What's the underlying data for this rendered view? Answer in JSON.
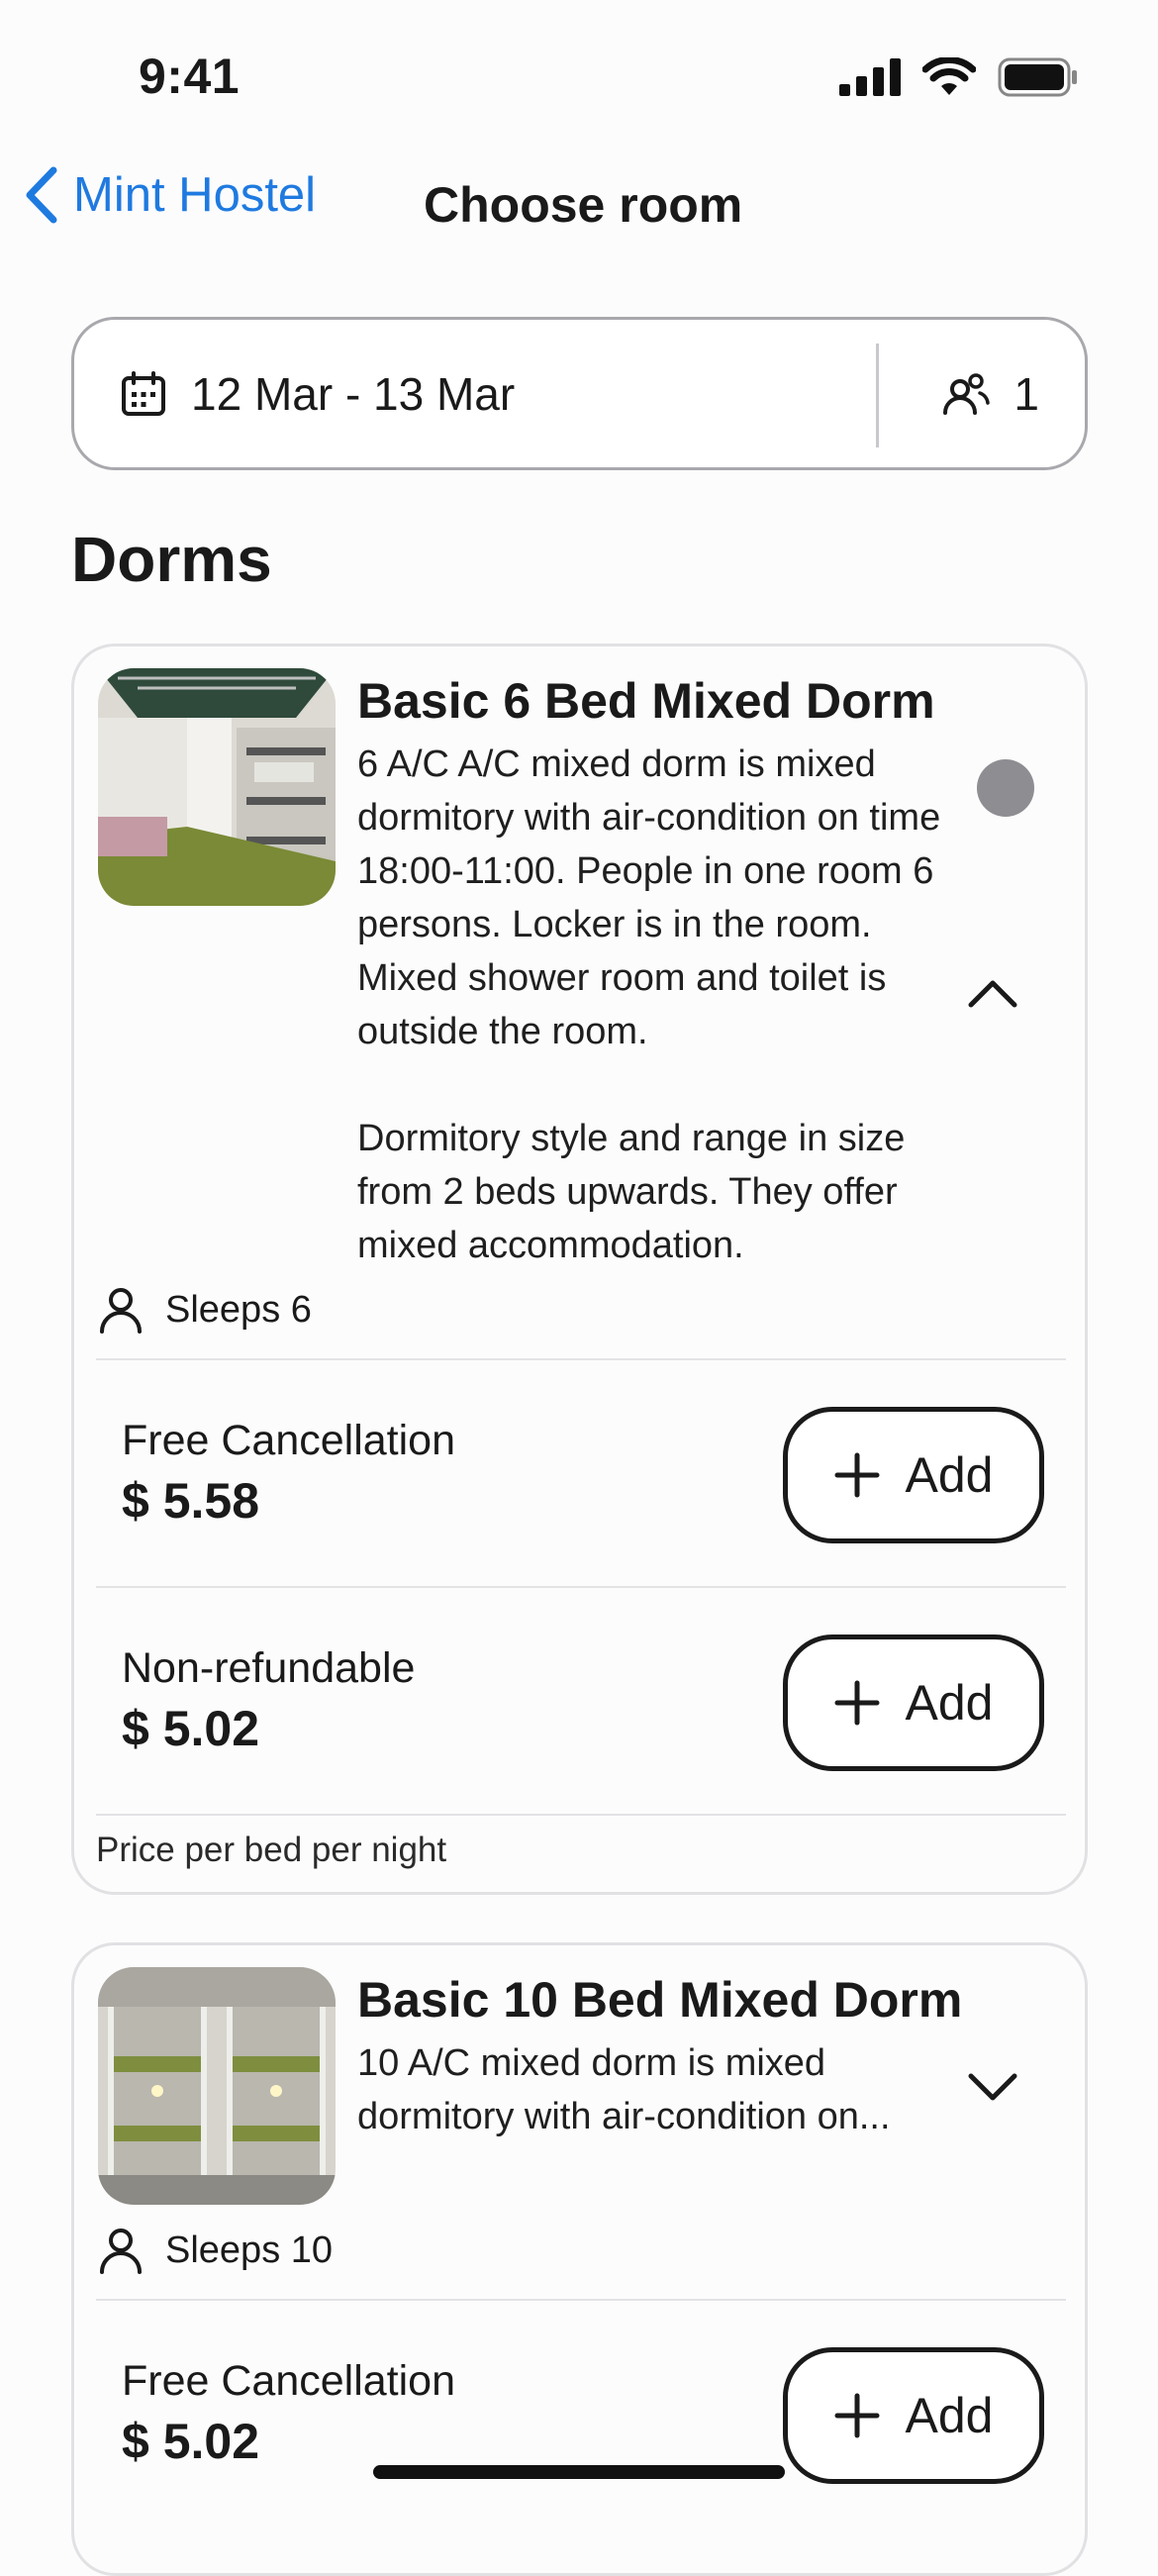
{
  "status_bar": {
    "time": "9:41"
  },
  "nav": {
    "back_label": "Mint Hostel",
    "title": "Choose room"
  },
  "search": {
    "dates": "12 Mar - 13 Mar",
    "guests": "1"
  },
  "section": {
    "title": "Dorms"
  },
  "rooms": [
    {
      "name": "Basic 6 Bed Mixed Dorm",
      "description": "6 A/C A/C mixed dorm is mixed dormitory with air-condition on time 18:00-11:00. People in one room 6 persons. Locker is in the room. Mixed shower room and toilet is outside the room.\n\nDormitory style and range in size from 2 beds upwards.  They offer mixed accommodation.",
      "sleeps": "Sleeps 6",
      "expanded": true,
      "rates": [
        {
          "label": "Free Cancellation",
          "price": "$ 5.58",
          "button": "Add"
        },
        {
          "label": "Non-refundable",
          "price": "$ 5.02",
          "button": "Add"
        }
      ],
      "footnote": "Price per bed per night"
    },
    {
      "name": "Basic 10 Bed Mixed Dorm",
      "description": "10 A/C mixed dorm is mixed dormitory with air-condition on...",
      "sleeps": "Sleeps 10",
      "expanded": false,
      "rates": [
        {
          "label": "Free Cancellation",
          "price": "$ 5.02",
          "button": "Add"
        }
      ]
    }
  ],
  "icons": {
    "back": "chevron-left-icon",
    "calendar": "calendar-icon",
    "guests": "users-icon",
    "person": "person-icon",
    "plus": "plus-icon",
    "collapse": "chevron-up-icon",
    "expand": "chevron-down-icon"
  },
  "colors": {
    "accent": "#1f7ae0",
    "radio": "#8d8d92",
    "border": "#a8a8ad"
  }
}
